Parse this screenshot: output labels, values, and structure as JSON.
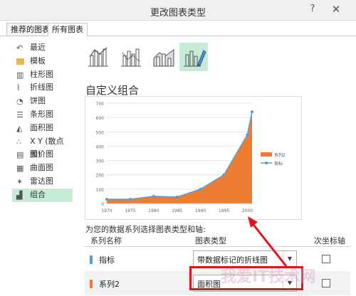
{
  "dialog": {
    "title": "更改图表类型",
    "help_glyph": "?",
    "close_glyph": "✕"
  },
  "tabs": [
    "推荐的图表",
    "所有图表"
  ],
  "sidebar": {
    "items": [
      {
        "label": "最近",
        "icon": "recent-icon"
      },
      {
        "label": "模板",
        "icon": "folder-icon"
      },
      {
        "label": "柱形图",
        "icon": "column-chart-icon"
      },
      {
        "label": "折线图",
        "icon": "line-chart-icon"
      },
      {
        "label": "饼图",
        "icon": "pie-chart-icon"
      },
      {
        "label": "条形图",
        "icon": "bar-chart-icon"
      },
      {
        "label": "面积图",
        "icon": "area-chart-icon"
      },
      {
        "label": "X Y (散点图)",
        "icon": "scatter-chart-icon"
      },
      {
        "label": "股价图",
        "icon": "stock-chart-icon"
      },
      {
        "label": "曲面图",
        "icon": "surface-chart-icon"
      },
      {
        "label": "雷达图",
        "icon": "radar-chart-icon"
      },
      {
        "label": "组合",
        "icon": "combo-chart-icon"
      }
    ],
    "active_index": 11
  },
  "combo_label": "自定义组合",
  "prompt": "为您的数据系列选择图表类型和轴:",
  "table": {
    "headers": [
      "系列名称",
      "图表类型",
      "次坐标轴"
    ],
    "rows": [
      {
        "name": "指标",
        "type": "带数据标记的折线图",
        "color": "#5b9bd5",
        "secondary": false
      },
      {
        "name": "系列2",
        "type": "面积图",
        "color": "#ed7d31",
        "secondary": false
      }
    ]
  },
  "colors": {
    "accent": "#c6ecd7",
    "highlight": "#e3151a",
    "area": "#ed7d31",
    "line": "#5b9bd5"
  },
  "watermark": "我爱IT技术网",
  "chart_data": {
    "type": "area",
    "x": [
      1970,
      1975,
      1980,
      1985,
      1990,
      1995,
      2000,
      2001
    ],
    "xticks": [
      "1970",
      "1975",
      "1980",
      "1985",
      "1990",
      "1995",
      "2000"
    ],
    "series": [
      {
        "name": "系列2",
        "type": "area",
        "values": [
          30,
          30,
          50,
          45,
          100,
          200,
          480,
          640
        ]
      },
      {
        "name": "指标",
        "type": "line",
        "values": [
          30,
          30,
          50,
          45,
          100,
          200,
          480,
          640
        ]
      }
    ],
    "ylim": [
      0,
      700
    ],
    "yticks": [
      "0",
      "100",
      "200",
      "300",
      "400",
      "500",
      "600",
      "700"
    ],
    "legend_position": "right"
  }
}
